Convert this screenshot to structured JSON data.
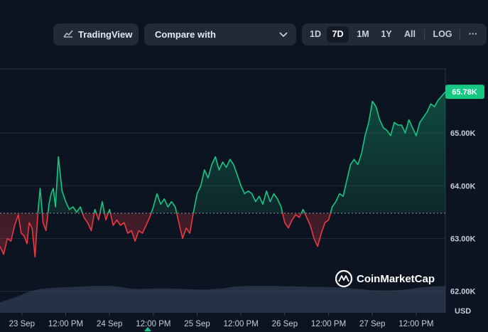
{
  "toolbar": {
    "tradingview_label": "TradingView",
    "compare_label": "Compare with",
    "ranges": [
      "1D",
      "7D",
      "1M",
      "1Y",
      "All"
    ],
    "active_range": "7D",
    "log_label": "LOG",
    "more_label": "···"
  },
  "watermark": "CoinMarketCap",
  "chart_data": {
    "type": "area",
    "currency": "USD",
    "current_price_label": "65.78K",
    "baseline": 63.48,
    "ylim": [
      61.7,
      66.2
    ],
    "y_ticks": [
      {
        "value": 62.0,
        "label": "62.00K"
      },
      {
        "value": 63.0,
        "label": "63.00K"
      },
      {
        "value": 64.0,
        "label": "64.00K"
      },
      {
        "value": 65.0,
        "label": "65.00K"
      }
    ],
    "x_labels": [
      "23 Sep",
      "12:00 PM",
      "24 Sep",
      "12:00 PM",
      "25 Sep",
      "12:00 PM",
      "26 Sep",
      "12:00 PM",
      "27 Sep",
      "12:00 PM"
    ],
    "x_range_hours": [
      0,
      122
    ],
    "x_label_hours": [
      6,
      18,
      30,
      42,
      54,
      66,
      78,
      90,
      102,
      114
    ],
    "series": [
      {
        "hours": [
          0,
          1,
          2,
          3,
          4,
          5,
          5.8,
          6.6,
          7.4,
          8,
          8.8,
          9.6,
          10.4,
          11,
          11.8,
          12.6,
          13.4,
          14,
          14.6,
          15.2,
          16,
          17,
          18,
          19,
          20,
          21,
          22,
          23,
          24,
          25,
          26,
          27,
          28,
          29,
          30,
          31,
          32,
          33,
          34,
          35,
          36,
          37,
          38,
          39,
          40,
          41,
          42,
          43,
          44,
          45,
          46,
          47,
          48,
          49,
          50,
          51,
          52,
          53,
          54,
          55,
          56,
          57,
          58,
          59,
          60,
          61,
          62,
          63,
          64,
          65,
          66,
          67,
          68,
          69,
          70,
          71,
          72,
          73,
          74,
          75,
          76,
          77,
          78,
          79,
          80,
          81,
          82,
          83,
          84,
          85,
          86,
          87,
          88,
          89,
          90,
          91,
          92,
          93,
          94,
          95,
          96,
          97,
          98,
          99,
          100,
          101,
          102,
          103,
          104,
          105,
          106,
          107,
          108,
          109,
          110,
          111,
          112,
          113,
          114,
          115,
          116,
          117,
          118,
          119,
          120,
          121,
          122
        ],
        "values": [
          62.85,
          62.7,
          63.0,
          62.95,
          63.25,
          63.45,
          63.1,
          63.05,
          62.9,
          63.3,
          63.2,
          62.65,
          63.5,
          63.95,
          63.3,
          63.15,
          63.65,
          63.85,
          63.95,
          63.6,
          64.55,
          63.9,
          63.7,
          63.55,
          63.6,
          63.5,
          63.6,
          63.4,
          63.3,
          63.15,
          63.55,
          63.35,
          63.7,
          63.35,
          63.55,
          63.25,
          63.35,
          63.25,
          63.3,
          63.1,
          63.15,
          62.95,
          63.15,
          63.1,
          63.25,
          63.4,
          63.6,
          63.85,
          63.65,
          63.75,
          63.6,
          63.7,
          63.6,
          63.3,
          63.0,
          63.2,
          63.1,
          63.5,
          63.85,
          64.0,
          64.3,
          64.15,
          64.4,
          64.55,
          64.3,
          64.45,
          64.35,
          64.5,
          64.4,
          64.2,
          64.0,
          63.85,
          63.9,
          63.85,
          63.7,
          63.8,
          63.65,
          63.9,
          63.7,
          63.85,
          63.75,
          63.6,
          63.3,
          63.2,
          63.35,
          63.45,
          63.4,
          63.55,
          63.4,
          63.25,
          63.0,
          62.85,
          63.1,
          63.3,
          63.35,
          63.6,
          63.7,
          63.85,
          63.8,
          64.1,
          64.4,
          64.5,
          64.4,
          64.6,
          64.95,
          65.2,
          65.6,
          65.5,
          65.25,
          65.1,
          65.05,
          64.95,
          65.2,
          65.15,
          65.15,
          65.0,
          65.25,
          65.1,
          64.95,
          65.2,
          65.3,
          65.4,
          65.55,
          65.5,
          65.62,
          65.7,
          65.78
        ]
      }
    ],
    "volume": [
      0.35,
      0.42,
      0.5,
      0.58,
      0.68,
      0.75,
      0.8,
      0.82,
      0.84,
      0.85,
      0.86,
      0.87,
      0.88,
      0.89,
      0.9,
      0.9,
      0.9,
      0.89,
      0.86,
      0.82,
      0.8,
      0.8,
      0.81,
      0.82,
      0.82,
      0.82,
      0.81,
      0.8,
      0.79,
      0.78,
      0.78,
      0.78,
      0.8,
      0.82,
      0.85,
      0.88,
      0.89,
      0.9,
      0.9,
      0.9,
      0.9,
      0.9,
      0.89,
      0.89,
      0.88,
      0.88,
      0.87,
      0.87,
      0.87,
      0.86,
      0.85,
      0.85,
      0.82,
      0.8,
      0.78,
      0.76,
      0.75,
      0.75,
      0.75,
      0.76,
      0.78,
      0.8,
      0.84,
      0.86,
      0.88,
      0.89,
      0.9
    ],
    "colors": {
      "up": "#16c784",
      "down": "#ea3943",
      "price_tag": "#16c784",
      "background": "#0d1421",
      "volume": "#3a4a66"
    }
  }
}
